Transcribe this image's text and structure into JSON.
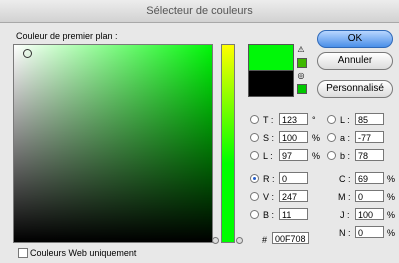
{
  "window": {
    "title": "Sélecteur de couleurs"
  },
  "picker": {
    "label": "Couleur de premier plan :"
  },
  "buttons": {
    "ok": "OK",
    "cancel": "Annuler",
    "custom": "Personnalisé"
  },
  "colors": {
    "new": "#00F708",
    "current": "#000000",
    "warn_square": "#3fb800",
    "web_square": "#00c800"
  },
  "icons": {
    "warning": "warning-icon",
    "web": "web-safe-icon"
  },
  "hsb": {
    "h_label": "T :",
    "h_value": "123",
    "h_unit": "°",
    "s_label": "S :",
    "s_value": "100",
    "s_unit": "%",
    "b_label": "L :",
    "b_value": "97",
    "b_unit": "%"
  },
  "rgb": {
    "r_label": "R :",
    "r_value": "0",
    "g_label": "V :",
    "g_value": "247",
    "b_label": "B :",
    "b_value": "11"
  },
  "lab": {
    "l_label": "L :",
    "l_value": "85",
    "a_label": "a :",
    "a_value": "-77",
    "b_label": "b :",
    "b_value": "78"
  },
  "cmyk": {
    "c_label": "C :",
    "c_value": "69",
    "m_label": "M :",
    "m_value": "0",
    "y_label": "J :",
    "y_value": "100",
    "k_label": "N :",
    "k_value": "0",
    "unit": "%"
  },
  "hex": {
    "label": "#",
    "value": "00F708"
  },
  "web_only": {
    "label": "Couleurs Web uniquement"
  }
}
